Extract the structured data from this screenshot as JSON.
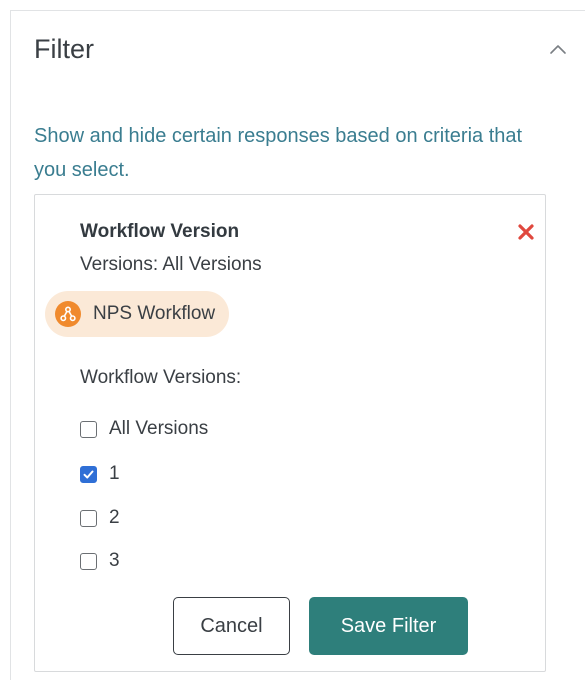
{
  "panel": {
    "title": "Filter",
    "collapse_icon": "chevron-up-icon",
    "description": "Show and hide certain responses based on criteria that you select."
  },
  "filter_card": {
    "title": "Workflow Version",
    "subtitle": "Versions: All Versions",
    "remove_icon": "close-icon",
    "remove_color": "#e0483e",
    "workflow": {
      "label": "NPS Workflow",
      "icon": "workflow-icon",
      "icon_color": "#f08a2d",
      "pill_color": "#fbe9d7"
    },
    "versions_label": "Workflow Versions:",
    "options": [
      {
        "label": "All Versions",
        "checked": false
      },
      {
        "label": "1",
        "checked": true
      },
      {
        "label": "2",
        "checked": false
      },
      {
        "label": "3",
        "checked": false
      }
    ],
    "cancel_label": "Cancel",
    "save_label": "Save Filter"
  },
  "colors": {
    "accent_text": "#3a7d90",
    "primary_button": "#2e7f7b",
    "checkbox_checked": "#2f6fd6"
  }
}
